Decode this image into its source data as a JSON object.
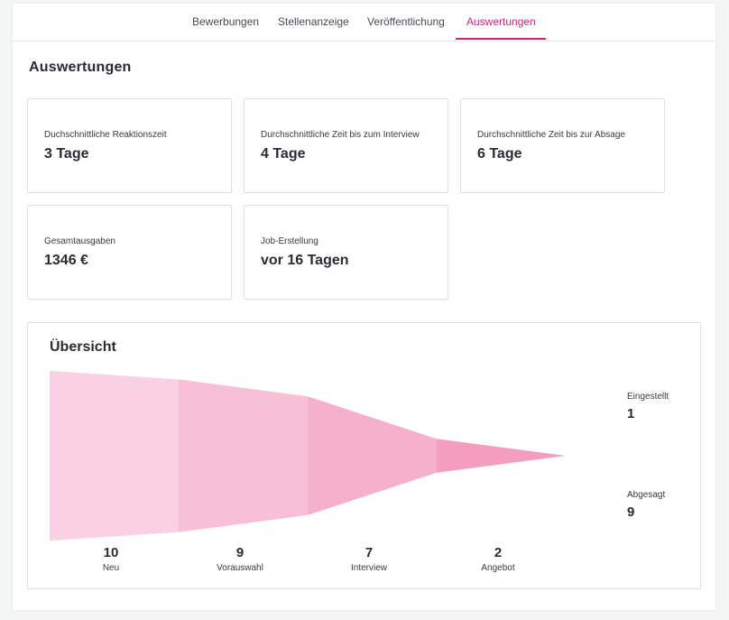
{
  "tabs": [
    {
      "label": "Bewerbungen",
      "active": false
    },
    {
      "label": "Stellenanzeige",
      "active": false
    },
    {
      "label": "Veröffentlichung",
      "active": false
    },
    {
      "label": "Auswertungen",
      "active": true
    }
  ],
  "section_title": "Auswertungen",
  "stats": [
    {
      "label": "Duchschnittliche Reaktionszeit",
      "value": "3 Tage"
    },
    {
      "label": "Durchschnittliche Zeit bis zum Interview",
      "value": "4 Tage"
    },
    {
      "label": "Durchschnittliche Zeit bis zur Absage",
      "value": "6 Tage"
    },
    {
      "label": "Gesamtausgaben",
      "value": "1346 €"
    },
    {
      "label": "Job-Erstellung",
      "value": "vor 16 Tagen"
    }
  ],
  "overview": {
    "title": "Übersicht",
    "side": {
      "hired_label": "Eingestellt",
      "hired_value": "1",
      "rejected_label": "Abgesagt",
      "rejected_value": "9"
    }
  },
  "chart_data": {
    "type": "area",
    "categories": [
      "Neu",
      "Vorauswahl",
      "Interview",
      "Angebot"
    ],
    "values": [
      10,
      9,
      7,
      2
    ],
    "colors": [
      "#fad1e3",
      "#f7c0d8",
      "#f5b0cc",
      "#f39ebf"
    ]
  }
}
